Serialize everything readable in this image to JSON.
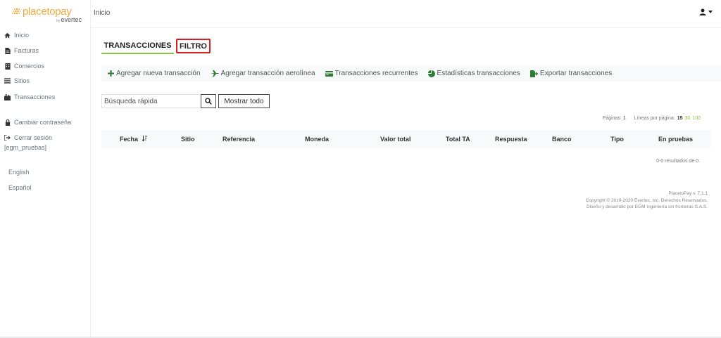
{
  "brand": {
    "logo_main": "placetopay",
    "logo_sub_by": "by",
    "logo_sub_name": "evertec",
    "accent_color": "#f2a93b",
    "green": "#8bc34a"
  },
  "sidebar": {
    "items": [
      {
        "label": "Inicio",
        "icon": "home-icon"
      },
      {
        "label": "Facturas",
        "icon": "file-icon"
      },
      {
        "label": "Comercios",
        "icon": "building-icon"
      },
      {
        "label": "Sitios",
        "icon": "list-icon"
      },
      {
        "label": "Transacciones",
        "icon": "exchange-icon"
      }
    ],
    "change_password": "Cambiar contraseña",
    "logout": "Cerrar sesión",
    "username": "[egm_pruebas]",
    "languages": [
      "English",
      "Español"
    ]
  },
  "header": {
    "breadcrumb": "Inicio",
    "user_icon": "user-icon"
  },
  "tabs": [
    {
      "label": "TRANSACCIONES",
      "active": true
    },
    {
      "label": "FILTRO",
      "highlighted": true
    }
  ],
  "actions": [
    {
      "label": "Agregar nueva transacción",
      "icon": "plus-icon"
    },
    {
      "label": "Agregar transacción aerolínea",
      "icon": "plane-icon"
    },
    {
      "label": "Transacciones recurrentes",
      "icon": "credit-card-icon"
    },
    {
      "label": "Estadísticas transacciones",
      "icon": "pie-chart-icon"
    },
    {
      "label": "Exportar transacciones",
      "icon": "file-export-icon"
    }
  ],
  "search": {
    "placeholder": "Búsqueda rápida",
    "show_all": "Mostrar todo"
  },
  "pagination": {
    "pages_label": "Páginas:",
    "pages_value": "1",
    "per_page_label": "Líneas por página:",
    "per_page_options": [
      "15",
      "30",
      "100"
    ]
  },
  "table": {
    "columns": [
      "Fecha",
      "Sitio",
      "Referencia",
      "Moneda",
      "Valor total",
      "Total TA",
      "Respuesta",
      "Banco",
      "Tipo",
      "En pruebas"
    ],
    "results_text": "0-0 resultados de 0."
  },
  "footer": {
    "version": "PlacetoPay v. 7.1.1",
    "copyright": "Copyright © 2019-2020 Evertec, Inc. Derechos Reservados.",
    "credits": "Diseño y desarrollo por EGM Ingeniería sin fronteras S.A.S."
  }
}
